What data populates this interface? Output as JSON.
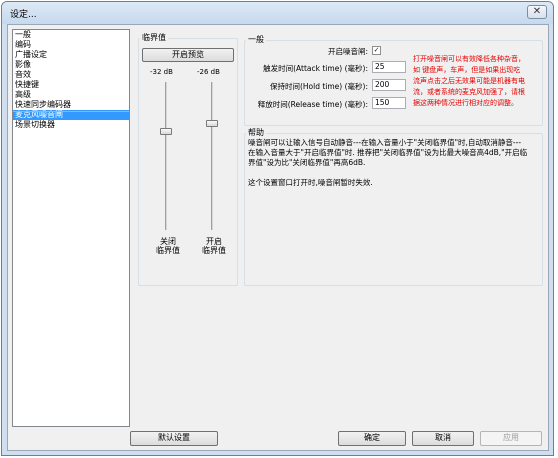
{
  "window": {
    "title": "设定...",
    "close_glyph": "✕"
  },
  "sidebar": {
    "items": [
      {
        "label": "一般"
      },
      {
        "label": "编码"
      },
      {
        "label": "广播设定"
      },
      {
        "label": "影像"
      },
      {
        "label": "音效"
      },
      {
        "label": "快捷键"
      },
      {
        "label": "高级"
      },
      {
        "label": "快速同步编码器"
      },
      {
        "label": "麦克风噪音闸",
        "selected": true
      },
      {
        "label": "场景切换器"
      }
    ]
  },
  "threshold": {
    "group_label": "临界值",
    "preview_button": "开启预览",
    "close_db": "-32 dB",
    "open_db": "-26 dB",
    "close_label_1": "关闭",
    "close_label_2": "临界值",
    "open_label_1": "开启",
    "open_label_2": "临界值"
  },
  "general": {
    "group_label": "一般",
    "enable_label": "开启噪音闸:",
    "enable_checked": true,
    "check_glyph": "✓",
    "attack_label": "触发时间(Attack time) (毫秒):",
    "attack_value": "25",
    "hold_label": "保持时间(Hold time) (毫秒):",
    "hold_value": "200",
    "release_label": "释放时间(Release time) (毫秒):",
    "release_value": "150",
    "note_lines": [
      "打开噪音闸可以有效降低各种杂音，",
      "如 键盘声，车声，但是如果出现吃",
      "流声点击之后无效果可能是机器有电",
      "流，或者系统的麦克风加强了，请根",
      "据这两种情况进行相对应的调整。"
    ]
  },
  "help": {
    "group_label": "帮助",
    "lines": [
      "噪音闸可以让输入信号自动静音---在输入音量小于\"关闭临界值\"时,自动取消静音---",
      "在输入音量大于\"开启临界值\"时. 推荐把\"关闭临界值\"设为比最大噪音高4dB,\"开启临",
      "界值\"设为比\"关闭临界值\"再高6dB.",
      "",
      "这个设置窗口打开时,噪音闸暂时失效."
    ]
  },
  "footer": {
    "defaults_button": "默认设置",
    "ok_button": "确定",
    "cancel_button": "取消",
    "apply_button": "应用"
  }
}
